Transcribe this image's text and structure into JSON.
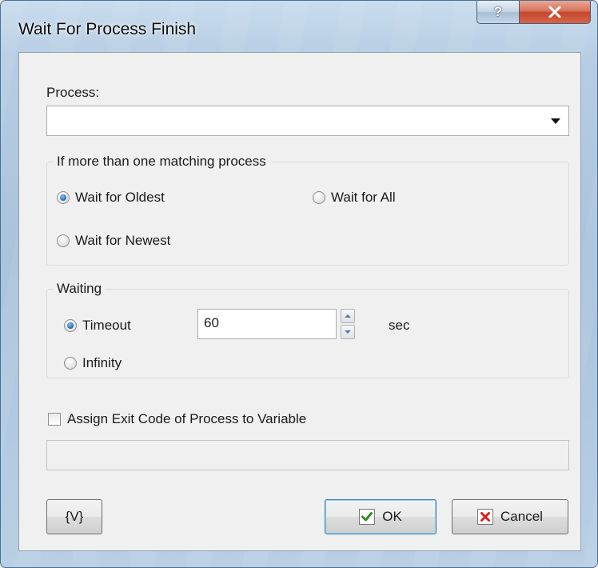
{
  "window": {
    "title": "Wait For Process Finish",
    "help_label": "?"
  },
  "process": {
    "label": "Process:",
    "value": ""
  },
  "multi_group": {
    "title": "If more than one matching process",
    "options": [
      {
        "label": "Wait for Oldest",
        "checked": true
      },
      {
        "label": "Wait for All",
        "checked": false
      },
      {
        "label": "Wait for Newest",
        "checked": false
      }
    ]
  },
  "waiting": {
    "title": "Waiting",
    "timeout_label": "Timeout",
    "timeout_checked": true,
    "timeout_value": "60",
    "unit": "sec",
    "infinity_label": "Infinity",
    "infinity_checked": false
  },
  "assign": {
    "label": "Assign Exit Code of Process to Variable",
    "checked": false,
    "value": ""
  },
  "buttons": {
    "variables": "{V}",
    "ok": "OK",
    "cancel": "Cancel"
  },
  "colors": {
    "ok_check": "#2f8f23",
    "cancel_x": "#d8201c",
    "close_bg": "#c4472d"
  }
}
